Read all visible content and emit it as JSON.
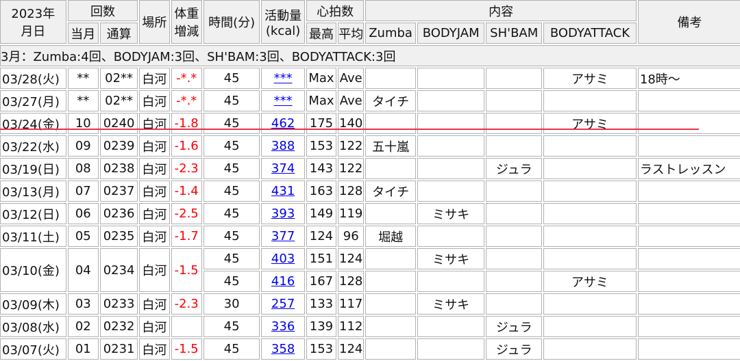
{
  "header": {
    "year_date": "2023年\n月日",
    "year": "2023年",
    "monthday": "月日",
    "count": "回数",
    "count_month": "当月",
    "count_total": "通算",
    "place": "場所",
    "weight": "体重\n増減",
    "weight_a": "体重",
    "weight_b": "増減",
    "time": "時間(分)",
    "activity_a": "活動量",
    "activity_b": "(kcal)",
    "heart": "心拍数",
    "heart_max": "最高",
    "heart_avg": "平均",
    "content": "内容",
    "zumba": "Zumba",
    "bodyjam": "BODYJAM",
    "shbam": "SH'BAM",
    "bodyattack": "BODYATTACK",
    "notes": "備考"
  },
  "summary": "3月：Zumba:4回、BODYJAM:3回、SH'BAM:3回、BODYATTACK:3回",
  "rows": [
    {
      "date": "03/28(火)",
      "month": "**",
      "total": "02**",
      "place": "白河",
      "weight": "-*.*",
      "time": "45",
      "kcal": "***",
      "max": "Max",
      "avg": "Ave",
      "zumba": "",
      "bodyjam": "",
      "shbam": "",
      "bodyattack": "アサミ",
      "notes": "18時～"
    },
    {
      "date": "03/27(月)",
      "month": "**",
      "total": "02**",
      "place": "白河",
      "weight": "-*.*",
      "time": "45",
      "kcal": "***",
      "max": "Max",
      "avg": "Ave",
      "zumba": "タイチ",
      "bodyjam": "",
      "shbam": "",
      "bodyattack": "",
      "notes": ""
    },
    {
      "date": "03/24(金)",
      "month": "10",
      "total": "0240",
      "place": "白河",
      "weight": "-1.8",
      "time": "45",
      "kcal": "462",
      "max": "175",
      "avg": "140",
      "zumba": "",
      "bodyjam": "",
      "shbam": "",
      "bodyattack": "アサミ",
      "notes": ""
    },
    {
      "date": "03/22(水)",
      "month": "09",
      "total": "0239",
      "place": "白河",
      "weight": "-1.6",
      "time": "45",
      "kcal": "388",
      "max": "153",
      "avg": "122",
      "zumba": "五十嵐",
      "bodyjam": "",
      "shbam": "",
      "bodyattack": "",
      "notes": ""
    },
    {
      "date": "03/19(日)",
      "month": "08",
      "total": "0238",
      "place": "白河",
      "weight": "-2.3",
      "time": "45",
      "kcal": "374",
      "max": "143",
      "avg": "122",
      "zumba": "",
      "bodyjam": "",
      "shbam": "ジュラ",
      "bodyattack": "",
      "notes": "ラストレッスン"
    },
    {
      "date": "03/13(月)",
      "month": "07",
      "total": "0237",
      "place": "白河",
      "weight": "-1.4",
      "time": "45",
      "kcal": "431",
      "max": "163",
      "avg": "128",
      "zumba": "タイチ",
      "bodyjam": "",
      "shbam": "",
      "bodyattack": "",
      "notes": ""
    },
    {
      "date": "03/12(日)",
      "month": "06",
      "total": "0236",
      "place": "白河",
      "weight": "-2.5",
      "time": "45",
      "kcal": "393",
      "max": "149",
      "avg": "119",
      "zumba": "",
      "bodyjam": "ミサキ",
      "shbam": "",
      "bodyattack": "",
      "notes": ""
    },
    {
      "date": "03/11(土)",
      "month": "05",
      "total": "0235",
      "place": "白河",
      "weight": "-1.7",
      "time": "45",
      "kcal": "377",
      "max": "124",
      "avg": "96",
      "zumba": "堀越",
      "bodyjam": "",
      "shbam": "",
      "bodyattack": "",
      "notes": ""
    }
  ],
  "row_0310": {
    "date": "03/10(金)",
    "month": "04",
    "total": "0234",
    "place": "白河",
    "weight": "-1.5",
    "sub": [
      {
        "time": "45",
        "kcal": "403",
        "max": "151",
        "avg": "124",
        "zumba": "",
        "bodyjam": "ミサキ",
        "shbam": "",
        "bodyattack": "",
        "notes": ""
      },
      {
        "time": "45",
        "kcal": "416",
        "max": "167",
        "avg": "128",
        "zumba": "",
        "bodyjam": "",
        "shbam": "",
        "bodyattack": "アサミ",
        "notes": ""
      }
    ]
  },
  "rows_after": [
    {
      "date": "03/09(木)",
      "month": "03",
      "total": "0233",
      "place": "白河",
      "weight": "-2.3",
      "time": "30",
      "kcal": "257",
      "max": "133",
      "avg": "117",
      "zumba": "",
      "bodyjam": "ミサキ",
      "shbam": "",
      "bodyattack": "",
      "notes": ""
    },
    {
      "date": "03/08(水)",
      "month": "02",
      "total": "0232",
      "place": "白河",
      "weight": "",
      "time": "45",
      "kcal": "336",
      "max": "139",
      "avg": "112",
      "zumba": "",
      "bodyjam": "",
      "shbam": "ジュラ",
      "bodyattack": "",
      "notes": ""
    },
    {
      "date": "03/07(火)",
      "month": "01",
      "total": "0231",
      "place": "白河",
      "weight": "-1.5",
      "time": "45",
      "kcal": "358",
      "max": "153",
      "avg": "124",
      "zumba": "",
      "bodyjam": "",
      "shbam": "ジュラ",
      "bodyattack": "",
      "notes": ""
    }
  ],
  "colors": {
    "red": "#ff0000",
    "link": "#0000ee",
    "header_bg": "#f0f0f0",
    "border": "#b0b0b0",
    "divider": "#e8324a"
  }
}
